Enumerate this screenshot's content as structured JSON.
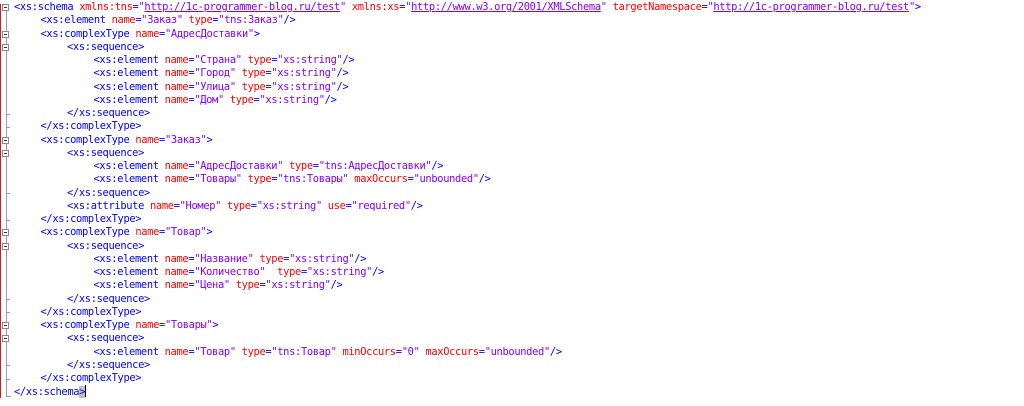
{
  "editor": {
    "language": "xml",
    "theme": {
      "tag": "#0000ff",
      "attribute": "#ff0000",
      "value": "#8000ff",
      "text": "#000000",
      "gutter_rule": "#d7191c",
      "bracket_highlight": "#c0c0c0"
    },
    "fold_icon": "fold-collapse-icon",
    "lines": [
      {
        "indent": 0,
        "fold": true,
        "parts": [
          {
            "t": "tag",
            "v": "<xs:schema"
          },
          {
            "t": "attr",
            "v": " xmlns:tns"
          },
          {
            "t": "punct",
            "v": "="
          },
          {
            "t": "val",
            "v": "\""
          },
          {
            "t": "url",
            "v": "http://1c-programmer-blog.ru/test"
          },
          {
            "t": "val",
            "v": "\""
          },
          {
            "t": "attr",
            "v": " xmlns:xs"
          },
          {
            "t": "punct",
            "v": "="
          },
          {
            "t": "val",
            "v": "\""
          },
          {
            "t": "url",
            "v": "http://www.w3.org/2001/XMLSchema"
          },
          {
            "t": "val",
            "v": "\""
          },
          {
            "t": "attr",
            "v": " targetNamespace"
          },
          {
            "t": "punct",
            "v": "="
          },
          {
            "t": "val",
            "v": "\""
          },
          {
            "t": "url",
            "v": "http://1c-programmer-blog.ru/test"
          },
          {
            "t": "val",
            "v": "\""
          },
          {
            "t": "tag",
            "v": ">"
          }
        ]
      },
      {
        "indent": 1,
        "fold": false,
        "parts": [
          {
            "t": "tag",
            "v": "<xs:element"
          },
          {
            "t": "attr",
            "v": " name"
          },
          {
            "t": "punct",
            "v": "="
          },
          {
            "t": "val",
            "v": "\"Заказ\""
          },
          {
            "t": "attr",
            "v": " type"
          },
          {
            "t": "punct",
            "v": "="
          },
          {
            "t": "val",
            "v": "\"tns:Заказ\""
          },
          {
            "t": "tag",
            "v": "/>"
          }
        ]
      },
      {
        "indent": 1,
        "fold": true,
        "parts": [
          {
            "t": "tag",
            "v": "<xs:complexType"
          },
          {
            "t": "attr",
            "v": " name"
          },
          {
            "t": "punct",
            "v": "="
          },
          {
            "t": "val",
            "v": "\"АдресДоставки\""
          },
          {
            "t": "tag",
            "v": ">"
          }
        ]
      },
      {
        "indent": 2,
        "fold": true,
        "parts": [
          {
            "t": "tag",
            "v": "<xs:sequence>"
          }
        ]
      },
      {
        "indent": 3,
        "fold": false,
        "parts": [
          {
            "t": "tag",
            "v": "<xs:element"
          },
          {
            "t": "attr",
            "v": " name"
          },
          {
            "t": "punct",
            "v": "="
          },
          {
            "t": "val",
            "v": "\"Страна\""
          },
          {
            "t": "attr",
            "v": " type"
          },
          {
            "t": "punct",
            "v": "="
          },
          {
            "t": "val",
            "v": "\"xs:string\""
          },
          {
            "t": "tag",
            "v": "/>"
          }
        ]
      },
      {
        "indent": 3,
        "fold": false,
        "parts": [
          {
            "t": "tag",
            "v": "<xs:element"
          },
          {
            "t": "attr",
            "v": " name"
          },
          {
            "t": "punct",
            "v": "="
          },
          {
            "t": "val",
            "v": "\"Город\""
          },
          {
            "t": "attr",
            "v": " type"
          },
          {
            "t": "punct",
            "v": "="
          },
          {
            "t": "val",
            "v": "\"xs:string\""
          },
          {
            "t": "tag",
            "v": "/>"
          }
        ]
      },
      {
        "indent": 3,
        "fold": false,
        "parts": [
          {
            "t": "tag",
            "v": "<xs:element"
          },
          {
            "t": "attr",
            "v": " name"
          },
          {
            "t": "punct",
            "v": "="
          },
          {
            "t": "val",
            "v": "\"Улица\""
          },
          {
            "t": "attr",
            "v": " type"
          },
          {
            "t": "punct",
            "v": "="
          },
          {
            "t": "val",
            "v": "\"xs:string\""
          },
          {
            "t": "tag",
            "v": "/>"
          }
        ]
      },
      {
        "indent": 3,
        "fold": false,
        "parts": [
          {
            "t": "tag",
            "v": "<xs:element"
          },
          {
            "t": "attr",
            "v": " name"
          },
          {
            "t": "punct",
            "v": "="
          },
          {
            "t": "val",
            "v": "\"Дом\""
          },
          {
            "t": "attr",
            "v": " type"
          },
          {
            "t": "punct",
            "v": "="
          },
          {
            "t": "val",
            "v": "\"xs:string\""
          },
          {
            "t": "tag",
            "v": "/>"
          }
        ]
      },
      {
        "indent": 2,
        "fold": false,
        "parts": [
          {
            "t": "tag",
            "v": "</xs:sequence>"
          }
        ]
      },
      {
        "indent": 1,
        "fold": false,
        "parts": [
          {
            "t": "tag",
            "v": "</xs:complexType>"
          }
        ]
      },
      {
        "indent": 1,
        "fold": true,
        "parts": [
          {
            "t": "tag",
            "v": "<xs:complexType"
          },
          {
            "t": "attr",
            "v": " name"
          },
          {
            "t": "punct",
            "v": "="
          },
          {
            "t": "val",
            "v": "\"Заказ\""
          },
          {
            "t": "tag",
            "v": ">"
          }
        ]
      },
      {
        "indent": 2,
        "fold": true,
        "parts": [
          {
            "t": "tag",
            "v": "<xs:sequence>"
          }
        ]
      },
      {
        "indent": 3,
        "fold": false,
        "parts": [
          {
            "t": "tag",
            "v": "<xs:element"
          },
          {
            "t": "attr",
            "v": " name"
          },
          {
            "t": "punct",
            "v": "="
          },
          {
            "t": "val",
            "v": "\"АдресДоставки\""
          },
          {
            "t": "attr",
            "v": " type"
          },
          {
            "t": "punct",
            "v": "="
          },
          {
            "t": "val",
            "v": "\"tns:АдресДоставки\""
          },
          {
            "t": "tag",
            "v": "/>"
          }
        ]
      },
      {
        "indent": 3,
        "fold": false,
        "parts": [
          {
            "t": "tag",
            "v": "<xs:element"
          },
          {
            "t": "attr",
            "v": " name"
          },
          {
            "t": "punct",
            "v": "="
          },
          {
            "t": "val",
            "v": "\"Товары\""
          },
          {
            "t": "attr",
            "v": " type"
          },
          {
            "t": "punct",
            "v": "="
          },
          {
            "t": "val",
            "v": "\"tns:Товары\""
          },
          {
            "t": "attr",
            "v": " maxOccurs"
          },
          {
            "t": "punct",
            "v": "="
          },
          {
            "t": "val",
            "v": "\"unbounded\""
          },
          {
            "t": "tag",
            "v": "/>"
          }
        ]
      },
      {
        "indent": 2,
        "fold": false,
        "parts": [
          {
            "t": "tag",
            "v": "</xs:sequence>"
          }
        ]
      },
      {
        "indent": 2,
        "fold": false,
        "parts": [
          {
            "t": "tag",
            "v": "<xs:attribute"
          },
          {
            "t": "attr",
            "v": " name"
          },
          {
            "t": "punct",
            "v": "="
          },
          {
            "t": "val",
            "v": "\"Номер\""
          },
          {
            "t": "attr",
            "v": " type"
          },
          {
            "t": "punct",
            "v": "="
          },
          {
            "t": "val",
            "v": "\"xs:string\""
          },
          {
            "t": "attr",
            "v": " use"
          },
          {
            "t": "punct",
            "v": "="
          },
          {
            "t": "val",
            "v": "\"required\""
          },
          {
            "t": "tag",
            "v": "/>"
          }
        ]
      },
      {
        "indent": 1,
        "fold": false,
        "parts": [
          {
            "t": "tag",
            "v": "</xs:complexType>"
          }
        ]
      },
      {
        "indent": 1,
        "fold": true,
        "parts": [
          {
            "t": "tag",
            "v": "<xs:complexType"
          },
          {
            "t": "attr",
            "v": " name"
          },
          {
            "t": "punct",
            "v": "="
          },
          {
            "t": "val",
            "v": "\"Товар\""
          },
          {
            "t": "tag",
            "v": ">"
          }
        ]
      },
      {
        "indent": 2,
        "fold": true,
        "parts": [
          {
            "t": "tag",
            "v": "<xs:sequence>"
          }
        ]
      },
      {
        "indent": 3,
        "fold": false,
        "parts": [
          {
            "t": "tag",
            "v": "<xs:element"
          },
          {
            "t": "attr",
            "v": " name"
          },
          {
            "t": "punct",
            "v": "="
          },
          {
            "t": "val",
            "v": "\"Название\""
          },
          {
            "t": "attr",
            "v": " type"
          },
          {
            "t": "punct",
            "v": "="
          },
          {
            "t": "val",
            "v": "\"xs:string\""
          },
          {
            "t": "tag",
            "v": "/>"
          }
        ]
      },
      {
        "indent": 3,
        "fold": false,
        "parts": [
          {
            "t": "tag",
            "v": "<xs:element"
          },
          {
            "t": "attr",
            "v": " name"
          },
          {
            "t": "punct",
            "v": "="
          },
          {
            "t": "val",
            "v": "\"Количество\""
          },
          {
            "t": "attr",
            "v": "  type"
          },
          {
            "t": "punct",
            "v": "="
          },
          {
            "t": "val",
            "v": "\"xs:string\""
          },
          {
            "t": "tag",
            "v": "/>"
          }
        ]
      },
      {
        "indent": 3,
        "fold": false,
        "parts": [
          {
            "t": "tag",
            "v": "<xs:element"
          },
          {
            "t": "attr",
            "v": " name"
          },
          {
            "t": "punct",
            "v": "="
          },
          {
            "t": "val",
            "v": "\"Цена\""
          },
          {
            "t": "attr",
            "v": " type"
          },
          {
            "t": "punct",
            "v": "="
          },
          {
            "t": "val",
            "v": "\"xs:string\""
          },
          {
            "t": "tag",
            "v": "/>"
          }
        ]
      },
      {
        "indent": 2,
        "fold": false,
        "parts": [
          {
            "t": "tag",
            "v": "</xs:sequence>"
          }
        ]
      },
      {
        "indent": 1,
        "fold": false,
        "parts": [
          {
            "t": "tag",
            "v": "</xs:complexType>"
          }
        ]
      },
      {
        "indent": 1,
        "fold": true,
        "parts": [
          {
            "t": "tag",
            "v": "<xs:complexType"
          },
          {
            "t": "attr",
            "v": " name"
          },
          {
            "t": "punct",
            "v": "="
          },
          {
            "t": "val",
            "v": "\"Товары\""
          },
          {
            "t": "tag",
            "v": ">"
          }
        ]
      },
      {
        "indent": 2,
        "fold": true,
        "parts": [
          {
            "t": "tag",
            "v": "<xs:sequence>"
          }
        ]
      },
      {
        "indent": 3,
        "fold": false,
        "parts": [
          {
            "t": "tag",
            "v": "<xs:element"
          },
          {
            "t": "attr",
            "v": " name"
          },
          {
            "t": "punct",
            "v": "="
          },
          {
            "t": "val",
            "v": "\"Товар\""
          },
          {
            "t": "attr",
            "v": " type"
          },
          {
            "t": "punct",
            "v": "="
          },
          {
            "t": "val",
            "v": "\"tns:Товар\""
          },
          {
            "t": "attr",
            "v": " minOccurs"
          },
          {
            "t": "punct",
            "v": "="
          },
          {
            "t": "val",
            "v": "\"0\""
          },
          {
            "t": "attr",
            "v": " maxOccurs"
          },
          {
            "t": "punct",
            "v": "="
          },
          {
            "t": "val",
            "v": "\"unbounded\""
          },
          {
            "t": "tag",
            "v": "/>"
          }
        ]
      },
      {
        "indent": 2,
        "fold": false,
        "parts": [
          {
            "t": "tag",
            "v": "</xs:sequence>"
          }
        ]
      },
      {
        "indent": 1,
        "fold": false,
        "parts": [
          {
            "t": "tag",
            "v": "</xs:complexType>"
          }
        ]
      },
      {
        "indent": 0,
        "fold": false,
        "caret": true,
        "parts": [
          {
            "t": "tag",
            "v": "</xs:schema"
          },
          {
            "t": "tag",
            "v": ">"
          }
        ]
      }
    ]
  }
}
